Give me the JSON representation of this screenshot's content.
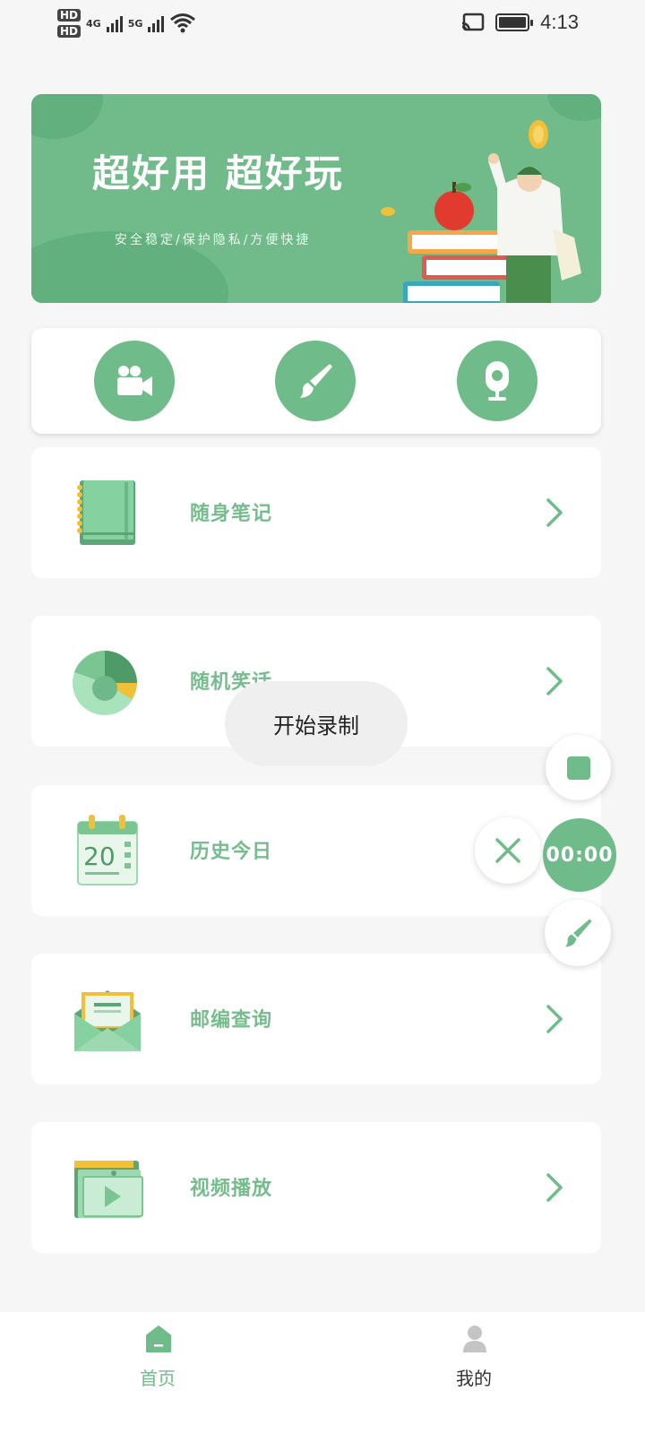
{
  "status_bar": {
    "hd1": "HD",
    "hd2": "HD",
    "net1": "4G",
    "net2": "5G",
    "time": "4:13"
  },
  "banner": {
    "title": "超好用 超好玩",
    "subtitle": "安全稳定/保护隐私/方便快捷"
  },
  "quick_actions": [
    {
      "icon": "video-camera-icon"
    },
    {
      "icon": "brush-icon"
    },
    {
      "icon": "webcam-icon"
    }
  ],
  "list_items": [
    {
      "label": "随身笔记",
      "icon": "notebook-icon"
    },
    {
      "label": "随机笑话",
      "icon": "pie-chart-icon"
    },
    {
      "label": "历史今日",
      "icon": "calendar-icon",
      "day": "20"
    },
    {
      "label": "邮编查询",
      "icon": "envelope-icon"
    },
    {
      "label": "视频播放",
      "icon": "video-folder-icon"
    }
  ],
  "toast": {
    "text": "开始录制"
  },
  "recorder": {
    "timer": "00:00"
  },
  "bottom_nav": [
    {
      "label": "首页",
      "icon": "home-icon",
      "active": true
    },
    {
      "label": "我的",
      "icon": "user-icon",
      "active": false
    }
  ],
  "colors": {
    "accent": "#6fbb89",
    "label": "#75bd8d",
    "background": "#f6f6f6"
  }
}
